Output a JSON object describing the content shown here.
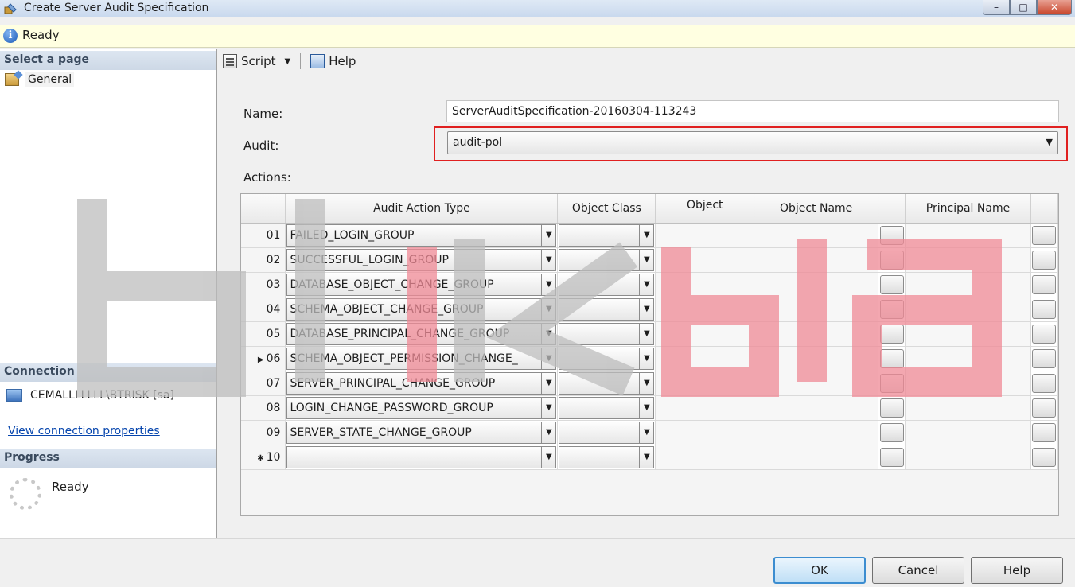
{
  "window": {
    "title": "Create Server Audit Specification",
    "min_icon": "minimize-icon",
    "max_icon": "maximize-icon",
    "close_icon": "close-icon",
    "min_glyph": "–",
    "max_glyph": "□",
    "close_glyph": "✕"
  },
  "status": {
    "text": "Ready",
    "info_glyph": "i"
  },
  "left": {
    "select_page_header": "Select a page",
    "pages": [
      {
        "label": "General"
      }
    ],
    "connection_header": "Connection",
    "connection_server": "CEMALLLLLLL\\BTRISK [sa]",
    "connection_link": "View connection properties",
    "progress_header": "Progress",
    "progress_text": "Ready"
  },
  "toolbar": {
    "script_label": "Script",
    "dropdown_glyph": "▼",
    "help_label": "Help"
  },
  "form": {
    "name_label": "Name:",
    "name_value": "ServerAuditSpecification-20160304-113243",
    "audit_label": "Audit:",
    "audit_value": "audit-pol",
    "audit_arrow": "▼",
    "actions_label": "Actions:"
  },
  "grid": {
    "columns": [
      "Audit Action Type",
      "Object Class",
      "Object",
      "Object Name",
      "Principal Name"
    ],
    "current_row_marker": "▶",
    "new_row_marker": "✱",
    "cbo_arrow": "▼",
    "rows": [
      {
        "num": "01",
        "action": "FAILED_LOGIN_GROUP"
      },
      {
        "num": "02",
        "action": "SUCCESSFUL_LOGIN_GROUP"
      },
      {
        "num": "03",
        "action": "DATABASE_OBJECT_CHANGE_GROUP"
      },
      {
        "num": "04",
        "action": "SCHEMA_OBJECT_CHANGE_GROUP"
      },
      {
        "num": "05",
        "action": "DATABASE_PRINCIPAL_CHANGE_GROUP"
      },
      {
        "num": "06",
        "action": "SCHEMA_OBJECT_PERMISSION_CHANGE_",
        "current": true
      },
      {
        "num": "07",
        "action": "SERVER_PRINCIPAL_CHANGE_GROUP"
      },
      {
        "num": "08",
        "action": "LOGIN_CHANGE_PASSWORD_GROUP"
      },
      {
        "num": "09",
        "action": "SERVER_STATE_CHANGE_GROUP"
      },
      {
        "num": "10",
        "action": "",
        "new": true
      }
    ]
  },
  "buttons": {
    "ok": "OK",
    "cancel": "Cancel",
    "help": "Help"
  },
  "colors": {
    "highlight": "#e02020",
    "watermark_gray": "#bdbdbd",
    "watermark_red": "#f08a96"
  }
}
